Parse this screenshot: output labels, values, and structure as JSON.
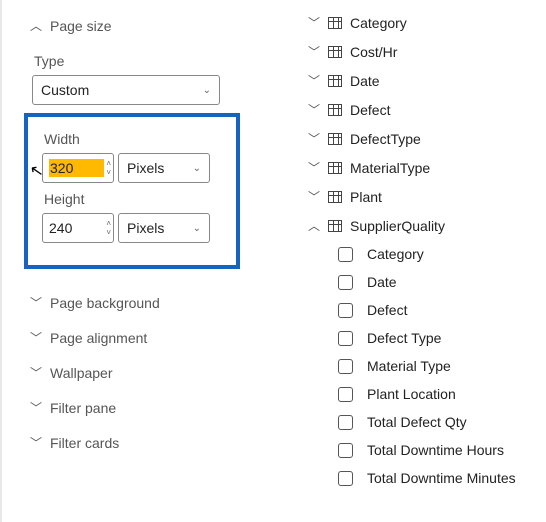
{
  "left": {
    "page_size": {
      "label": "Page size",
      "expanded": true
    },
    "type": {
      "label": "Type",
      "value": "Custom"
    },
    "width": {
      "label": "Width",
      "value": "320",
      "unit": "Pixels"
    },
    "height": {
      "label": "Height",
      "value": "240",
      "unit": "Pixels"
    },
    "sections": [
      {
        "label": "Page background",
        "expanded": false
      },
      {
        "label": "Page alignment",
        "expanded": false
      },
      {
        "label": "Wallpaper",
        "expanded": false
      },
      {
        "label": "Filter pane",
        "expanded": false
      },
      {
        "label": "Filter cards",
        "expanded": false
      }
    ]
  },
  "right": {
    "tables": [
      {
        "name": "Category",
        "expanded": false
      },
      {
        "name": "Cost/Hr",
        "expanded": false
      },
      {
        "name": "Date",
        "expanded": false
      },
      {
        "name": "Defect",
        "expanded": false
      },
      {
        "name": "DefectType",
        "expanded": false
      },
      {
        "name": "MaterialType",
        "expanded": false
      },
      {
        "name": "Plant",
        "expanded": false
      },
      {
        "name": "SupplierQuality",
        "expanded": true
      }
    ],
    "columns": [
      "Category",
      "Date",
      "Defect",
      "Defect Type",
      "Material Type",
      "Plant Location",
      "Total Defect Qty",
      "Total Downtime Hours",
      "Total Downtime Minutes"
    ]
  }
}
